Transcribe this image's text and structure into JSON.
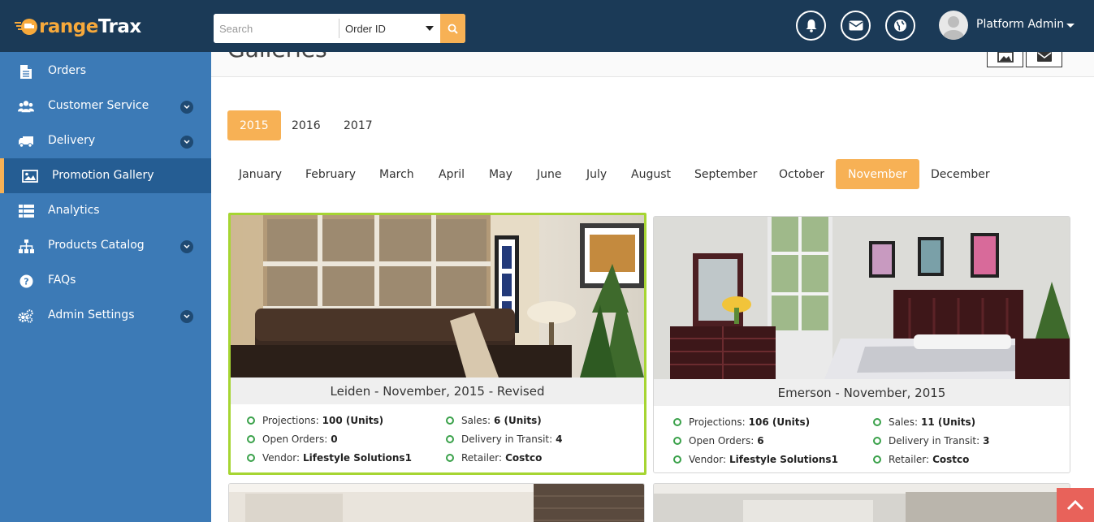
{
  "app": {
    "logo_first": "O",
    "logo_mid": "range",
    "logo_last": "Trax"
  },
  "search": {
    "placeholder": "Search",
    "type_selected": "Order ID"
  },
  "user": {
    "name": "Platform Admin"
  },
  "sidebar": {
    "items": [
      {
        "label": "Orders"
      },
      {
        "label": "Customer Service"
      },
      {
        "label": "Delivery"
      },
      {
        "label": "Promotion Gallery"
      },
      {
        "label": "Analytics"
      },
      {
        "label": "Products Catalog"
      },
      {
        "label": "FAQs"
      },
      {
        "label": "Admin Settings"
      }
    ]
  },
  "page": {
    "title": "Galleries"
  },
  "years": [
    "2015",
    "2016",
    "2017"
  ],
  "months": [
    "January",
    "February",
    "March",
    "April",
    "May",
    "June",
    "July",
    "August",
    "September",
    "October",
    "November",
    "December"
  ],
  "selected_year": "2015",
  "selected_month": "November",
  "cards": [
    {
      "title": "Leiden - November, 2015 - Revised",
      "projections_label": "Projections:",
      "projections": "100 (Units)",
      "sales_label": "Sales:",
      "sales": "6 (Units)",
      "open_label": "Open Orders:",
      "open": "0",
      "transit_label": "Delivery in Transit:",
      "transit": "4",
      "vendor_label": "Vendor:",
      "vendor": "Lifestyle Solutions1",
      "retailer_label": "Retailer:",
      "retailer": "Costco"
    },
    {
      "title": "Emerson - November, 2015",
      "projections_label": "Projections:",
      "projections": "106 (Units)",
      "sales_label": "Sales:",
      "sales": "11 (Units)",
      "open_label": "Open Orders:",
      "open": "6",
      "transit_label": "Delivery in Transit:",
      "transit": "3",
      "vendor_label": "Vendor:",
      "vendor": "Lifestyle Solutions1",
      "retailer_label": "Retailer:",
      "retailer": "Costco"
    }
  ],
  "colors": {
    "topbar": "#1b3a57",
    "sidebar": "#3c7ab6",
    "accent": "#f7b155",
    "selected_card_border": "#a6d532",
    "status_dot": "#3aa14a",
    "scroll_top": "#e8625a"
  }
}
